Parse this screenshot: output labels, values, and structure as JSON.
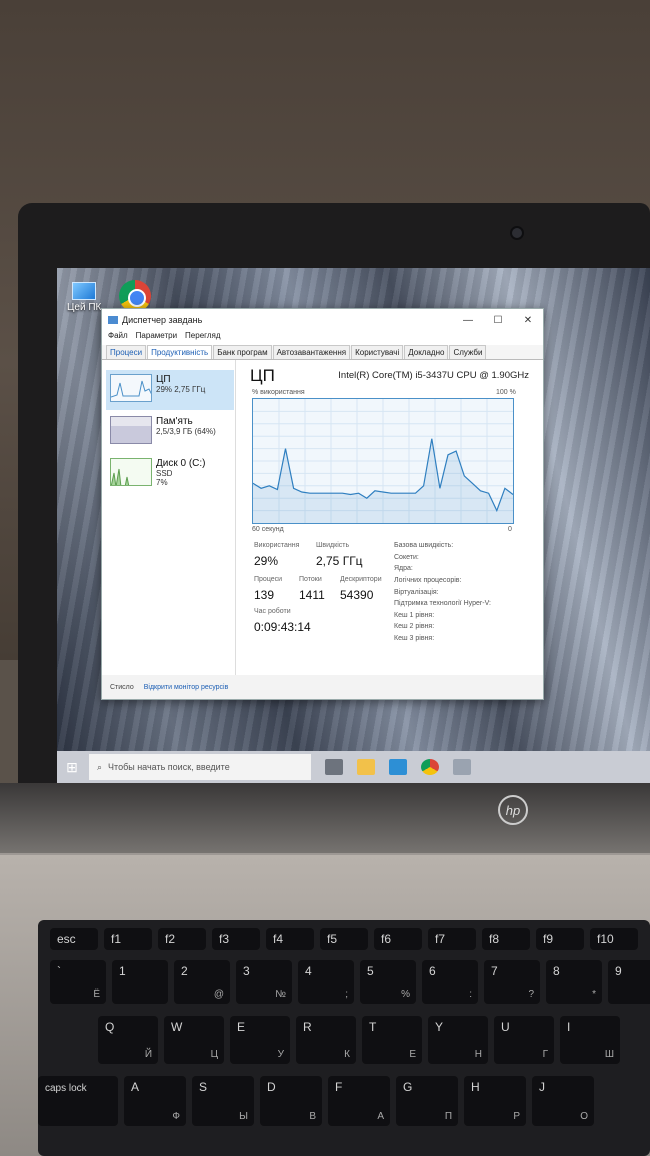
{
  "desktop": {
    "icons": [
      {
        "label": "Цей ПК",
        "icon": "this-pc-icon"
      },
      {
        "label": "",
        "icon": "chrome-icon"
      }
    ]
  },
  "window": {
    "title": "Диспетчер завдань",
    "controls": {
      "minimize": "—",
      "maximize": "☐",
      "close": "✕"
    },
    "menu": [
      "Файл",
      "Параметри",
      "Перегляд"
    ],
    "tabs": [
      "Процеси",
      "Продуктивність",
      "Банк програм",
      "Автозавантаження",
      "Користувачі",
      "Докладно",
      "Служби"
    ],
    "active_tab": "Продуктивність",
    "sidebar": [
      {
        "name": "ЦП",
        "detail": "29% 2,75 ГГц",
        "detail2": ""
      },
      {
        "name": "Пам'ять",
        "detail": "2,5/3,9 ГБ (64%)",
        "detail2": ""
      },
      {
        "name": "Диск 0 (C:)",
        "detail": "SSD",
        "detail2": "7%"
      }
    ],
    "cpu": {
      "title": "ЦП",
      "model": "Intel(R) Core(TM) i5-3437U CPU @ 1.90GHz",
      "graph_label": "% використання",
      "graph_max": "100 %",
      "graph_time": "60 секунд",
      "graph_min": "0",
      "usage_label": "Використання",
      "usage": "29%",
      "speed_label": "Швидкість",
      "speed": "2,75 ГГц",
      "processes_label": "Процеси",
      "processes": "139",
      "threads_label": "Потоки",
      "threads": "1411",
      "handles_label": "Дескриптори",
      "handles": "54390",
      "uptime_label": "Час роботи",
      "uptime": "0:09:43:14",
      "right_labels": [
        "Базова швидкість:",
        "Сокети:",
        "Ядра:",
        "Логічних процесорів:",
        "Віртуалізація:",
        "Підтримка технології Hyper-V:",
        "Кеш 1 рівня:",
        "Кеш 2 рівня:",
        "Кеш 3 рівня:"
      ]
    },
    "footer": {
      "less": "Стисло",
      "link": "Відкрити монітор ресурсів"
    }
  },
  "taskbar": {
    "search_placeholder": "Чтобы начать поиск, введите"
  },
  "laptop": {
    "brand": "hp",
    "keys_row1": [
      "esc",
      "f1",
      "f2",
      "f3",
      "f4",
      "f5",
      "f6",
      "f7",
      "f8",
      "f9",
      "f10"
    ],
    "keys_row2": [
      [
        "`",
        "Ё"
      ],
      [
        "1",
        ""
      ],
      [
        "2",
        "@"
      ],
      [
        "3",
        "№"
      ],
      [
        "4",
        ";"
      ],
      [
        "5",
        "%"
      ],
      [
        "6",
        ":"
      ],
      [
        "7",
        "?"
      ],
      [
        "8",
        "*"
      ],
      [
        "9",
        "("
      ]
    ],
    "keys_row3": [
      [
        "Q",
        "Й"
      ],
      [
        "W",
        "Ц"
      ],
      [
        "E",
        "У"
      ],
      [
        "R",
        "К"
      ],
      [
        "T",
        "Е"
      ],
      [
        "Y",
        "Н"
      ],
      [
        "U",
        "Г"
      ],
      [
        "I",
        "Ш"
      ]
    ],
    "keys_row4": [
      [
        "A",
        "Ф"
      ],
      [
        "S",
        "Ы"
      ],
      [
        "D",
        "В"
      ],
      [
        "F",
        "А"
      ],
      [
        "G",
        "П"
      ],
      [
        "H",
        "Р"
      ],
      [
        "J",
        "О"
      ]
    ],
    "caps": "caps lock",
    "colors": {
      "accent": "#1d5fb4",
      "graph": "#4a90c8"
    }
  },
  "chart_data": {
    "type": "line",
    "title": "% використання",
    "ylim": [
      0,
      100
    ],
    "y": [
      32,
      28,
      30,
      27,
      60,
      28,
      25,
      24,
      24,
      24,
      24,
      24,
      23,
      24,
      20,
      26,
      25,
      24,
      24,
      24,
      24,
      30,
      68,
      28,
      55,
      58,
      38,
      32,
      26,
      24,
      10,
      28,
      23
    ]
  }
}
